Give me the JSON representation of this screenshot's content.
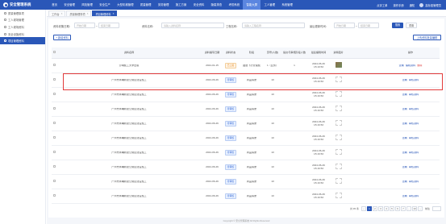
{
  "app": {
    "title": "安全管理系统"
  },
  "nav": [
    "首页",
    "安全管理",
    "风险管理",
    "安全生产",
    "大型机械管理",
    "质量管理",
    "劳务管理",
    "施工方案",
    "安全资料",
    "隐患排查",
    "考勤系统",
    "智能大屏",
    "工人管理",
    "系统管理"
  ],
  "nav_active_index": 11,
  "topright": {
    "item1": "点评工单",
    "item2": "操作手册",
    "item3": "通知",
    "user": "高标准管理员"
  },
  "sidebar": {
    "items": [
      "质量管理事项",
      "工人现场管理",
      "工人现场资料",
      "安全设施资料",
      "项目管理资料"
    ],
    "active_index": 4
  },
  "tabs": [
    {
      "label": "工作台"
    },
    {
      "label": "质量管理事项"
    },
    {
      "label": "项目管理资料"
    }
  ],
  "tabs_active_index": 2,
  "filters": {
    "label1": "资料收集日期：",
    "start1": "开始日期",
    "end1": "结束日期",
    "label2": "资料名称：",
    "placeholder2": "请输入资料名称",
    "label3": "工程名称：",
    "placeholder3": "请输入工程名称",
    "label4": "最后更新时间：",
    "start4": "开始日期",
    "end4": "结束日期",
    "search": "搜索",
    "reset": "重置"
  },
  "toolbar": {
    "add": "+ 新增资料",
    "import": "上传资料批量编辑"
  },
  "table": {
    "headers": [
      "资料名称",
      "资料编写日期",
      "资料状态",
      "阶段",
      "页号(人数)",
      "提交与审核阶段人数",
      "最后编辑时间",
      "资料图片",
      "操作"
    ],
    "rows": [
      {
        "name": "沙琳施工大学出版",
        "date": "2024-01-15",
        "status": "已上报",
        "status_type": "orange",
        "stage": "图层飞行管理施",
        "pages": "1（业务）",
        "count": "1",
        "edited": "2024-06-26\n15:19:53",
        "has_image": true,
        "ops": [
          "查看",
          "编辑资料",
          "删除"
        ]
      },
      {
        "name": "广州市黄埔新建公寓区建设施工",
        "date": "2024-06-26",
        "status": "待审核",
        "status_type": "blue",
        "stage": "商品房屋",
        "pages": "10",
        "count": "",
        "edited": "2024-06-26\n15:16:53",
        "has_image": false,
        "ops": [
          "查看",
          "审核资料"
        ]
      },
      {
        "name": "广州市黄埔新建公寓区建设施工",
        "date": "2024-06-26",
        "status": "待审核",
        "status_type": "blue",
        "stage": "商品房屋",
        "pages": "10",
        "count": "",
        "edited": "2024-06-26\n15:16:53",
        "has_image": false,
        "ops": [
          "查看",
          "审核资料"
        ]
      },
      {
        "name": "广州市黄埔新建公寓区建设施工",
        "date": "2024-06-26",
        "status": "待审核",
        "status_type": "blue",
        "stage": "商品房屋",
        "pages": "10",
        "count": "",
        "edited": "2024-06-26\n15:16:53",
        "has_image": false,
        "ops": [
          "查看",
          "审核资料"
        ]
      },
      {
        "name": "广州市黄埔新建公寓区建设施工",
        "date": "2024-06-26",
        "status": "待审核",
        "status_type": "blue",
        "stage": "商品房屋",
        "pages": "10",
        "count": "",
        "edited": "2024-06-26\n15:16:53",
        "has_image": false,
        "ops": [
          "查看",
          "审核资料"
        ]
      },
      {
        "name": "广州市黄埔新建公寓区建设施工",
        "date": "2024-06-26",
        "status": "待审核",
        "status_type": "blue",
        "stage": "商品房屋",
        "pages": "10",
        "count": "",
        "edited": "2024-06-26\n15:16:53",
        "has_image": false,
        "ops": [
          "查看",
          "审核资料"
        ]
      },
      {
        "name": "广州市黄埔新建公寓区建设施工",
        "date": "2024-06-26",
        "status": "待审核",
        "status_type": "blue",
        "stage": "商品房屋",
        "pages": "10",
        "count": "",
        "edited": "2024-06-26\n15:16:53",
        "has_image": false,
        "ops": [
          "查看",
          "审核资料"
        ]
      },
      {
        "name": "广州市黄埔新建公寓区建设施工",
        "date": "2024-06-26",
        "status": "待审核",
        "status_type": "blue",
        "stage": "商品房屋",
        "pages": "10",
        "count": "",
        "edited": "2024-06-26\n15:16:53",
        "has_image": false,
        "ops": [
          "查看",
          "审核资料"
        ]
      },
      {
        "name": "广州市黄埔新建公寓区建设施工",
        "date": "2024-06-26",
        "status": "待审核",
        "status_type": "blue",
        "stage": "商品房屋",
        "pages": "10",
        "count": "",
        "edited": "2024-06-26\n15:16:53",
        "has_image": false,
        "ops": [
          "查看",
          "审核资料"
        ]
      },
      {
        "name": "广州市黄埔新建公寓区建设施工",
        "date": "2024-06-26",
        "status": "待审核",
        "status_type": "blue",
        "stage": "商品房屋",
        "pages": "10",
        "count": "",
        "edited": "2024-06-26\n15:16:53",
        "has_image": false,
        "ops": [
          "查看",
          "审核资料"
        ]
      }
    ]
  },
  "pagination": {
    "total": "共 95 条",
    "pages": [
      "1",
      "2",
      "3",
      "4",
      "5",
      "6",
      "7",
      "...",
      "10"
    ],
    "active": 0,
    "goto": "前往"
  },
  "footer": "Copyright © 安全管理系统 All Rights Reserved",
  "colors": {
    "primary": "#2a57b8",
    "highlight": "#e23b3b"
  }
}
